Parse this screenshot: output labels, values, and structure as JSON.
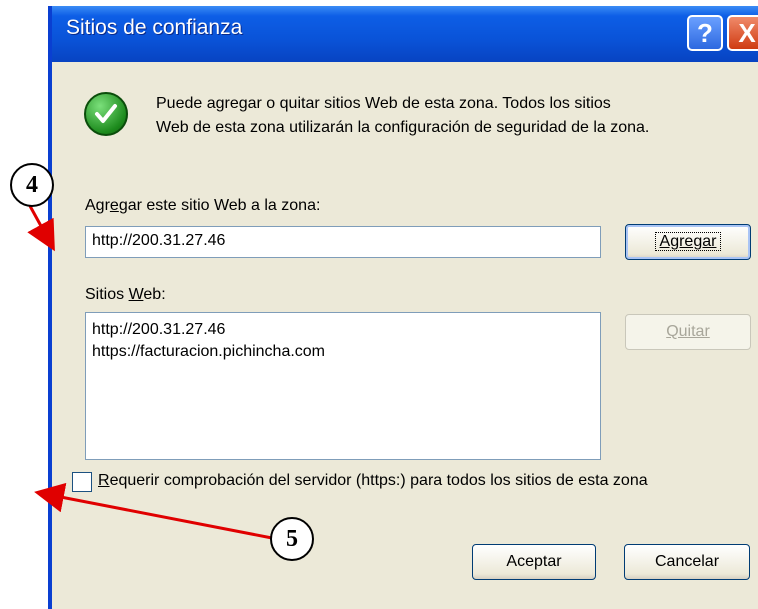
{
  "window": {
    "title": "Sitios de confianza",
    "help_glyph": "?",
    "close_glyph": "X"
  },
  "info": {
    "icon": "green-check-icon",
    "line1": "Puede agregar o quitar sitios Web de esta zona.  Todos los sitios",
    "line2": "Web de esta zona utilizarán la configuración de seguridad de la zona."
  },
  "add": {
    "label_pre": "Agr",
    "label_u": "e",
    "label_post": "gar este sitio Web a la zona:",
    "input_value": "http://200.31.27.46",
    "button_label": "Agregar"
  },
  "sites": {
    "label_pre": "Sitios ",
    "label_u": "W",
    "label_post": "eb:",
    "items": [
      "http://200.31.27.46",
      "https://facturacion.pichincha.com"
    ],
    "remove_label": "Quitar"
  },
  "https_check": {
    "label_u": "R",
    "label_post": "equerir comprobación del servidor (https:) para todos los sitios de esta zona",
    "checked": false
  },
  "footer": {
    "ok_label": "Aceptar",
    "cancel_label": "Cancelar"
  },
  "annotations": {
    "callout_4": "4",
    "callout_5": "5",
    "arrow_color": "#e00000"
  }
}
